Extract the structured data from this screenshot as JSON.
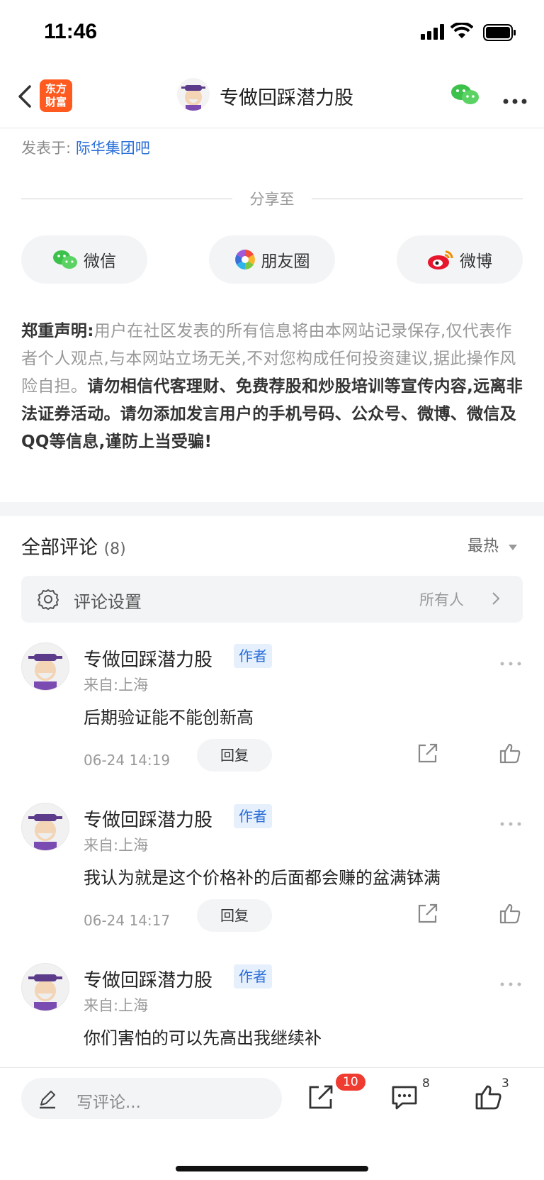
{
  "status_bar": {
    "time": "11:46"
  },
  "nav": {
    "logo_line1": "东方",
    "logo_line2": "财富",
    "title": "专做回踩潜力股"
  },
  "post": {
    "posted_prefix": "发表于:",
    "posted_in": "际华集团吧"
  },
  "share": {
    "title": "分享至",
    "buttons": [
      "微信",
      "朋友圈",
      "微博"
    ]
  },
  "disclaimer": {
    "label": "郑重声明:",
    "normal": "用户在社区发表的所有信息将由本网站记录保存,仅代表作者个人观点,与本网站立场无关,不对您构成任何投资建议,据此操作风险自担。",
    "bold": "请勿相信代客理财、免费荐股和炒股培训等宣传内容,远离非法证券活动。请勿添加发言用户的手机号码、公众号、微博、微信及QQ等信息,谨防上当受骗!"
  },
  "comments": {
    "title": "全部评论",
    "count": "(8)",
    "sort": "最热",
    "settings_label": "评论设置",
    "settings_value": "所有人",
    "items": [
      {
        "name": "专做回踩潜力股",
        "badge": "作者",
        "location": "来自:上海",
        "text": "后期验证能不能创新高",
        "time": "06-24 14:19",
        "reply": "回复"
      },
      {
        "name": "专做回踩潜力股",
        "badge": "作者",
        "location": "来自:上海",
        "text": "我认为就是这个价格补的后面都会赚的盆满钵满",
        "time": "06-24 14:17",
        "reply": "回复"
      },
      {
        "name": "专做回踩潜力股",
        "badge": "作者",
        "location": "来自:上海",
        "text": "你们害怕的可以先高出我继续补",
        "time": "",
        "reply": ""
      }
    ]
  },
  "bottom_bar": {
    "placeholder": "写评论...",
    "share_badge": "10",
    "comment_count": "8",
    "like_count": "3"
  },
  "colors": {
    "accent_blue": "#2a6ed8",
    "brand_orange": "#ff5a1f",
    "badge_red": "#ef3b30"
  }
}
